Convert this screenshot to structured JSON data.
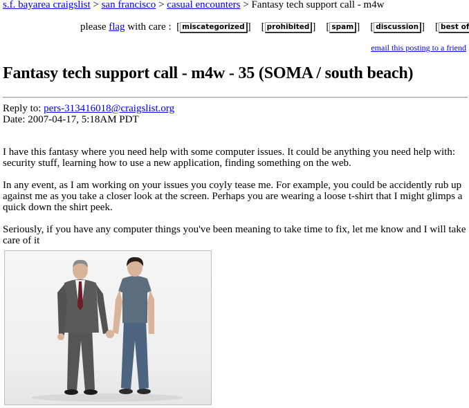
{
  "breadcrumb": {
    "items": [
      "s.f. bayarea craigslist",
      "san francisco",
      "casual encounters"
    ],
    "separator": ">",
    "current": "Fantasy tech support call - m4w"
  },
  "flagbar": {
    "prefix": "please",
    "flag_link": "flag",
    "suffix": "with care :",
    "buttons": [
      "miscategorized",
      "prohibited",
      "spam",
      "discussion",
      "best of"
    ]
  },
  "email_link": "email this posting to a friend",
  "title": "Fantasy tech support call - m4w - 35 (SOMA / south beach)",
  "meta": {
    "reply_label": "Reply to:",
    "reply_email": "pers-313416018@craigslist.org",
    "date_label": "Date:",
    "date_value": "2007-04-17, 5:18AM PDT"
  },
  "body": {
    "paragraphs": [
      "I have this fantasy where you need help with some computer issues. It could be anything you need help with: security stuff, learning how to use a new application, finding something on the web.",
      "In any event, as I am working on your issues you coyly tease me. For example, you could be accidently rub up against me as you take a closer look at the screen. Perhaps you are wearing a loose t-shirt that I might glimps a quick down the shirt peek.",
      "Seriously, if you have any computer things you've been meaning to take time to fix, let me know and I will take care of it"
    ]
  },
  "photo": {
    "colors": {
      "suit": "#5a5a5a",
      "tie": "#6b1f24",
      "jeans": "#4d6480",
      "tshirt": "#5c6d7e",
      "skin": "#d9b39a",
      "hair": "#2a1f18"
    }
  }
}
